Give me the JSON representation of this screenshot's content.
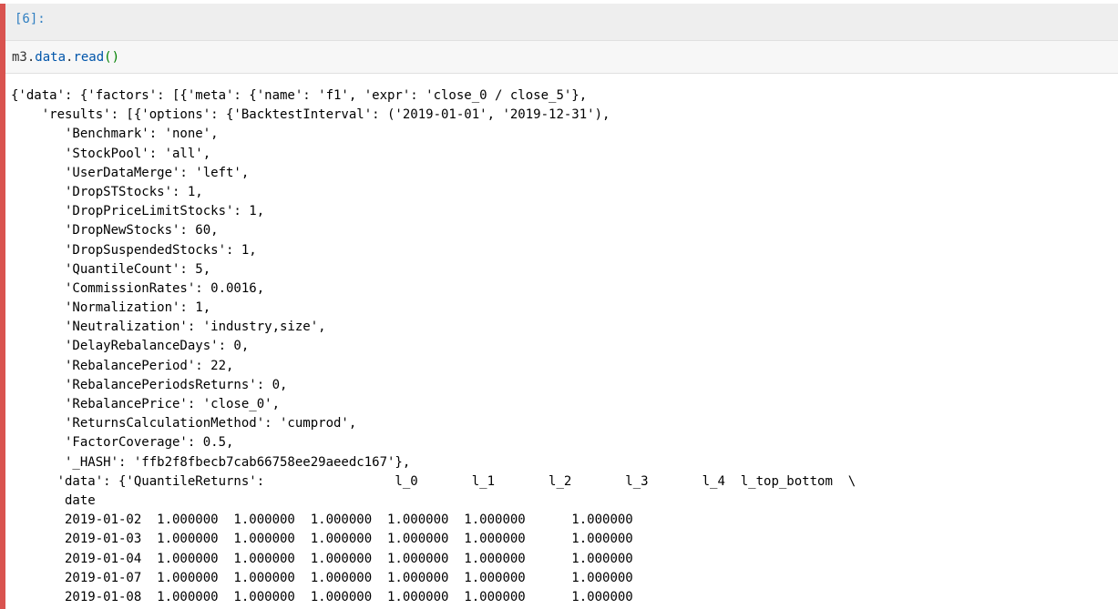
{
  "cell": {
    "prompt": "[6]:",
    "code": {
      "module": "m3",
      "dot1": ".",
      "attr1": "data",
      "dot2": ".",
      "attr2": "read",
      "parens": "()"
    }
  },
  "output": {
    "lines": [
      "{'data': {'factors': [{'meta': {'name': 'f1', 'expr': 'close_0 / close_5'},",
      "    'results': [{'options': {'BacktestInterval': ('2019-01-01', '2019-12-31'),",
      "       'Benchmark': 'none',",
      "       'StockPool': 'all',",
      "       'UserDataMerge': 'left',",
      "       'DropSTStocks': 1,",
      "       'DropPriceLimitStocks': 1,",
      "       'DropNewStocks': 60,",
      "       'DropSuspendedStocks': 1,",
      "       'QuantileCount': 5,",
      "       'CommissionRates': 0.0016,",
      "       'Normalization': 1,",
      "       'Neutralization': 'industry,size',",
      "       'DelayRebalanceDays': 0,",
      "       'RebalancePeriod': 22,",
      "       'RebalancePeriodsReturns': 0,",
      "       'RebalancePrice': 'close_0',",
      "       'ReturnsCalculationMethod': 'cumprod',",
      "       'FactorCoverage': 0.5,",
      "       '_HASH': 'ffb2f8fbecb7cab66758ee29aeedc167'},",
      "      'data': {'QuantileReturns':                 l_0       l_1       l_2       l_3       l_4  l_top_bottom  \\",
      "       date",
      "       2019-01-02  1.000000  1.000000  1.000000  1.000000  1.000000      1.000000",
      "       2019-01-03  1.000000  1.000000  1.000000  1.000000  1.000000      1.000000",
      "       2019-01-04  1.000000  1.000000  1.000000  1.000000  1.000000      1.000000",
      "       2019-01-07  1.000000  1.000000  1.000000  1.000000  1.000000      1.000000",
      "       2019-01-08  1.000000  1.000000  1.000000  1.000000  1.000000      1.000000"
    ]
  },
  "colors": {
    "left_bar": "#d9534f",
    "prompt": "#307fc1",
    "attr": "#0055aa",
    "parens": "#008000"
  }
}
